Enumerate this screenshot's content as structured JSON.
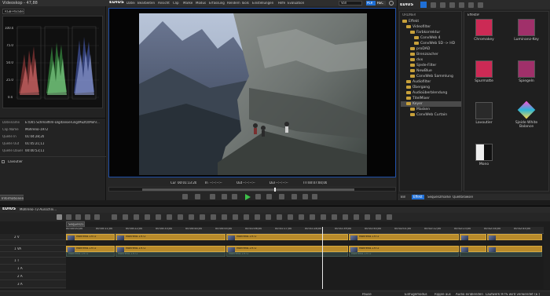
{
  "window": {
    "title": "Videoskop - 47,88",
    "app_name": "EDIUS",
    "menu": [
      "Datei",
      "Bearbeiten",
      "Ansicht",
      "Clip",
      "Marke",
      "Modus",
      "Erfassung",
      "Rendern",
      "Tools",
      "Einstellungen",
      "Hilfe",
      "Evaluation"
    ],
    "profile_value": "Voll",
    "plr_label": "PLR",
    "rec_label": "REC"
  },
  "scope": {
    "mode_value": "RGB-Parade",
    "y_ticks": [
      "100.0",
      "75.0",
      "50.0",
      "25.0",
      "0.0"
    ],
    "channels": [
      {
        "name": "R",
        "color": "#e05050"
      },
      {
        "name": "G",
        "color": "#50e060"
      },
      {
        "name": "B",
        "color": "#6080ff"
      }
    ]
  },
  "info": {
    "rows": [
      {
        "label": "Dateiname",
        "value": "E:\\005 Schmalfilm-Digitalisierung\\Muztz\\Mohr..."
      },
      {
        "label": "Clip Name",
        "value": "Mohreno-1972"
      },
      {
        "label": "Quelle In",
        "value": "01:04:28;20"
      },
      {
        "label": "Quelle Out",
        "value": "01:05:21;11"
      },
      {
        "label": "Quelle Dauer",
        "value": "00:00:53;11"
      }
    ],
    "effect_item": "Lavoutier",
    "tab_label": "Informationen"
  },
  "player": {
    "cue_label": "Cur",
    "cue_value": "00:01:13:20",
    "in_label": "In",
    "in_value": "--:--:--:--",
    "out_label": "Out",
    "out_value": "--:--:--:--",
    "dur_label": "Dur",
    "dur_value": "--:--:--:--",
    "ttl_label": "TTl",
    "ttl_value": "00:07:00;00"
  },
  "bin": {
    "app_name": "EDIUS",
    "folder_label": "ORDNER",
    "path": "Effekte\\",
    "tree": [
      {
        "label": "Effekt",
        "indent": 0
      },
      {
        "label": "Videofilter",
        "indent": 1
      },
      {
        "label": "Farbkorrektur",
        "indent": 2
      },
      {
        "label": "ConvWeb 4",
        "indent": 3
      },
      {
        "label": "ConvWeb SD -> HD",
        "indent": 3
      },
      {
        "label": "proDAD",
        "indent": 2
      },
      {
        "label": "Brenzsacher",
        "indent": 2
      },
      {
        "label": "dvx",
        "indent": 2
      },
      {
        "label": "Sjede-Filter",
        "indent": 2
      },
      {
        "label": "NewBlue",
        "indent": 2
      },
      {
        "label": "ConvWeb Sammlung",
        "indent": 2
      },
      {
        "label": "Audiofilter",
        "indent": 1
      },
      {
        "label": "Übergang",
        "indent": 1
      },
      {
        "label": "Audioüberblendung",
        "indent": 1
      },
      {
        "label": "TitelMixer",
        "indent": 1
      },
      {
        "label": "Keyer",
        "indent": 1
      },
      {
        "label": "Masken",
        "indent": 2
      },
      {
        "label": "ConvWeb Curtain",
        "indent": 2
      }
    ],
    "effects": [
      {
        "label": "Chromakey",
        "color": "#cc2a55"
      },
      {
        "label": "Luminanz-Key",
        "color": "#a0306a"
      },
      {
        "label": "Spurmatte",
        "color": "#cc2a55"
      },
      {
        "label": "Spiegeln",
        "color": "#a0306a"
      },
      {
        "label": "Lavoutier",
        "color": "#2a2a2a"
      },
      {
        "label": "Sjeide White Balance",
        "color": "#2bb6d6"
      },
      {
        "label": "Mono",
        "color": "#eeeeee"
      }
    ],
    "tabs": [
      "Bin",
      "Effekt",
      "Sequenzmarke",
      "Quellbrowser"
    ]
  },
  "timeline": {
    "app_name": "EDIUS",
    "project_name": "Mohreno-72-Ausschni...",
    "sequence_tab": "Sequenz1",
    "ruler": [
      "00:00:00;00",
      "00:00:11;00",
      "00:00:22;00",
      "00:00:33;00",
      "00:00:44;00",
      "00:00:55;00",
      "00:01:06;00",
      "00:01:17;00",
      "00:01:28;00",
      "00:01:39;00",
      "00:01:50;00",
      "00:02:01;00",
      "00:02:12;00",
      "00:02:23;00",
      "00:02:34;00",
      "00:02:45;00"
    ],
    "tracks": [
      "2 V",
      "",
      "1 VA",
      "",
      "1 T",
      "1 A",
      "2 A",
      "3 A"
    ],
    "clip_label": "Mohreno-1972",
    "status": {
      "pause": "Pause",
      "insert": "Einfügemodus",
      "ripple": "Ripple aus",
      "audio": "Audio einblenden",
      "space": "Laufwerk:97% wird verwendet (E:)"
    }
  },
  "colors": {
    "accent": "#1f6fd6",
    "clip_yellow": "#c8962c",
    "playhead": "#e8e8e8",
    "play_green": "#3dc04a"
  }
}
